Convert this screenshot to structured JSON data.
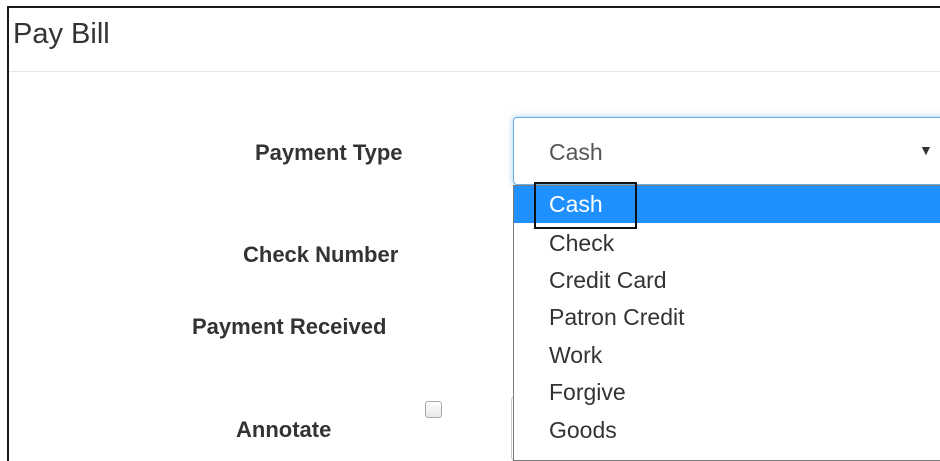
{
  "panel": {
    "title": "Pay Bill"
  },
  "form": {
    "payment_type_label": "Payment Type",
    "check_number_label": "Check Number",
    "payment_received_label": "Payment Received",
    "annotate_label": "Annotate",
    "annotate_checked": false
  },
  "payment_type_select": {
    "selected_value": "Cash",
    "arrow_icon": "triangle-down",
    "options": [
      {
        "label": "Cash",
        "highlighted": true
      },
      {
        "label": "Check",
        "highlighted": false
      },
      {
        "label": "Credit Card",
        "highlighted": false
      },
      {
        "label": "Patron Credit",
        "highlighted": false
      },
      {
        "label": "Work",
        "highlighted": false
      },
      {
        "label": "Forgive",
        "highlighted": false
      },
      {
        "label": "Goods",
        "highlighted": false
      }
    ],
    "highlight_color": "#1e90ff"
  }
}
